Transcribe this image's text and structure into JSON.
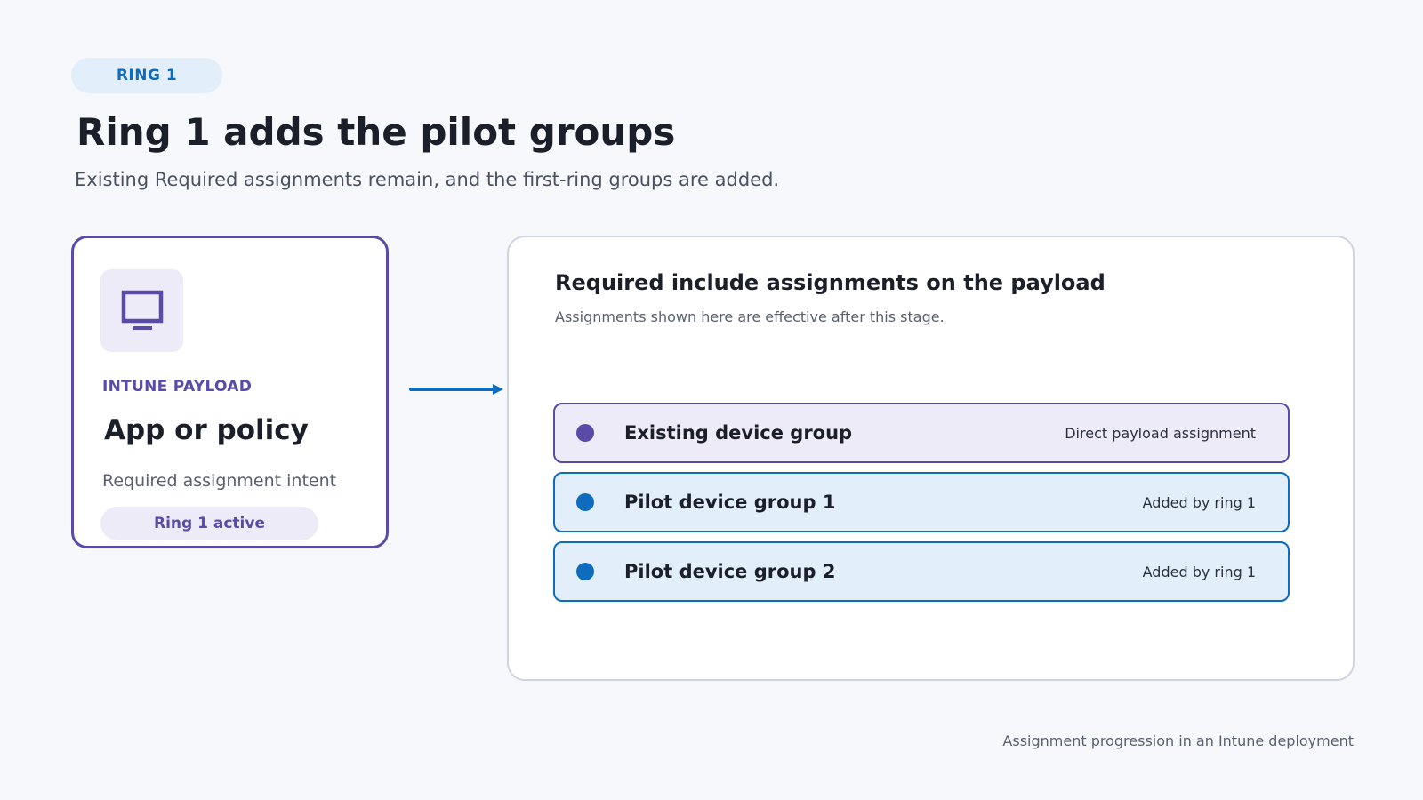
{
  "stage_badge": "RING 1",
  "title": "Ring 1 adds the pilot groups",
  "subtitle": "Existing Required assignments remain, and the first-ring groups are added.",
  "payload": {
    "icon": "monitor-icon",
    "kicker": "INTUNE PAYLOAD",
    "name": "App or policy",
    "intent": "Required assignment intent",
    "status": "Ring 1 active"
  },
  "assignments": {
    "title": "Required include assignments on the payload",
    "subtitle": "Assignments shown here are effective after this stage.",
    "groups": [
      {
        "name": "Existing device group",
        "source": "Direct payload assignment",
        "kind": "existing"
      },
      {
        "name": "Pilot device group 1",
        "source": "Added by ring 1",
        "kind": "pilot"
      },
      {
        "name": "Pilot device group 2",
        "source": "Added by ring 1",
        "kind": "pilot"
      }
    ]
  },
  "caption": "Assignment progression in an Intune deployment",
  "colors": {
    "purple_accent": "#5b4aa8",
    "blue_accent": "#0f6cbd",
    "purple_tint": "#eeebf9",
    "blue_tint": "#e2effb"
  }
}
